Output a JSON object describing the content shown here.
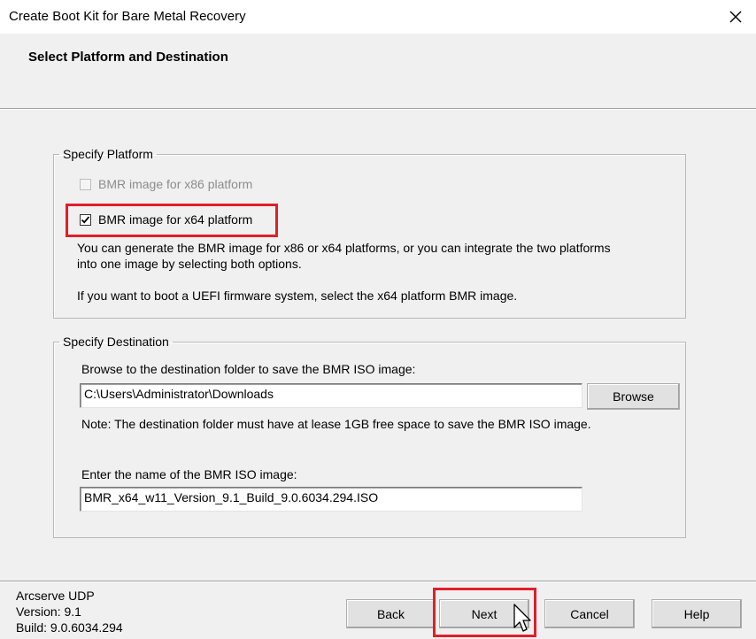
{
  "window": {
    "title": "Create Boot Kit for Bare Metal Recovery",
    "heading": "Select Platform and Destination"
  },
  "platform": {
    "legend": "Specify Platform",
    "x86_label": "BMR image for x86 platform",
    "x86_checked": false,
    "x86_enabled": false,
    "x64_label": "BMR image for x64 platform",
    "x64_checked": true,
    "desc_line1": "You can generate the BMR image for x86 or x64 platforms, or you can integrate the two platforms",
    "desc_line2": "into one image by selecting both options.",
    "uefi_note": "If you want to boot a UEFI firmware system, select the x64 platform BMR image."
  },
  "destination": {
    "legend": "Specify Destination",
    "browse_label": "Browse to the destination folder to save the BMR ISO image:",
    "folder_value": "C:\\Users\\Administrator\\Downloads",
    "browse_button": "Browse",
    "note": "Note: The destination folder must have at lease 1GB free space to save the BMR ISO image.",
    "name_label": "Enter the name of the BMR ISO image:",
    "name_value": "BMR_x64_w11_Version_9.1_Build_9.0.6034.294.ISO"
  },
  "footer": {
    "product": "Arcserve UDP",
    "version": "Version: 9.1",
    "build": "Build: 9.0.6034.294",
    "back": "Back",
    "next": "Next",
    "cancel": "Cancel",
    "help": "Help"
  },
  "colors": {
    "highlight": "#e01f2b",
    "dialog_bg": "#f0f0f0"
  }
}
